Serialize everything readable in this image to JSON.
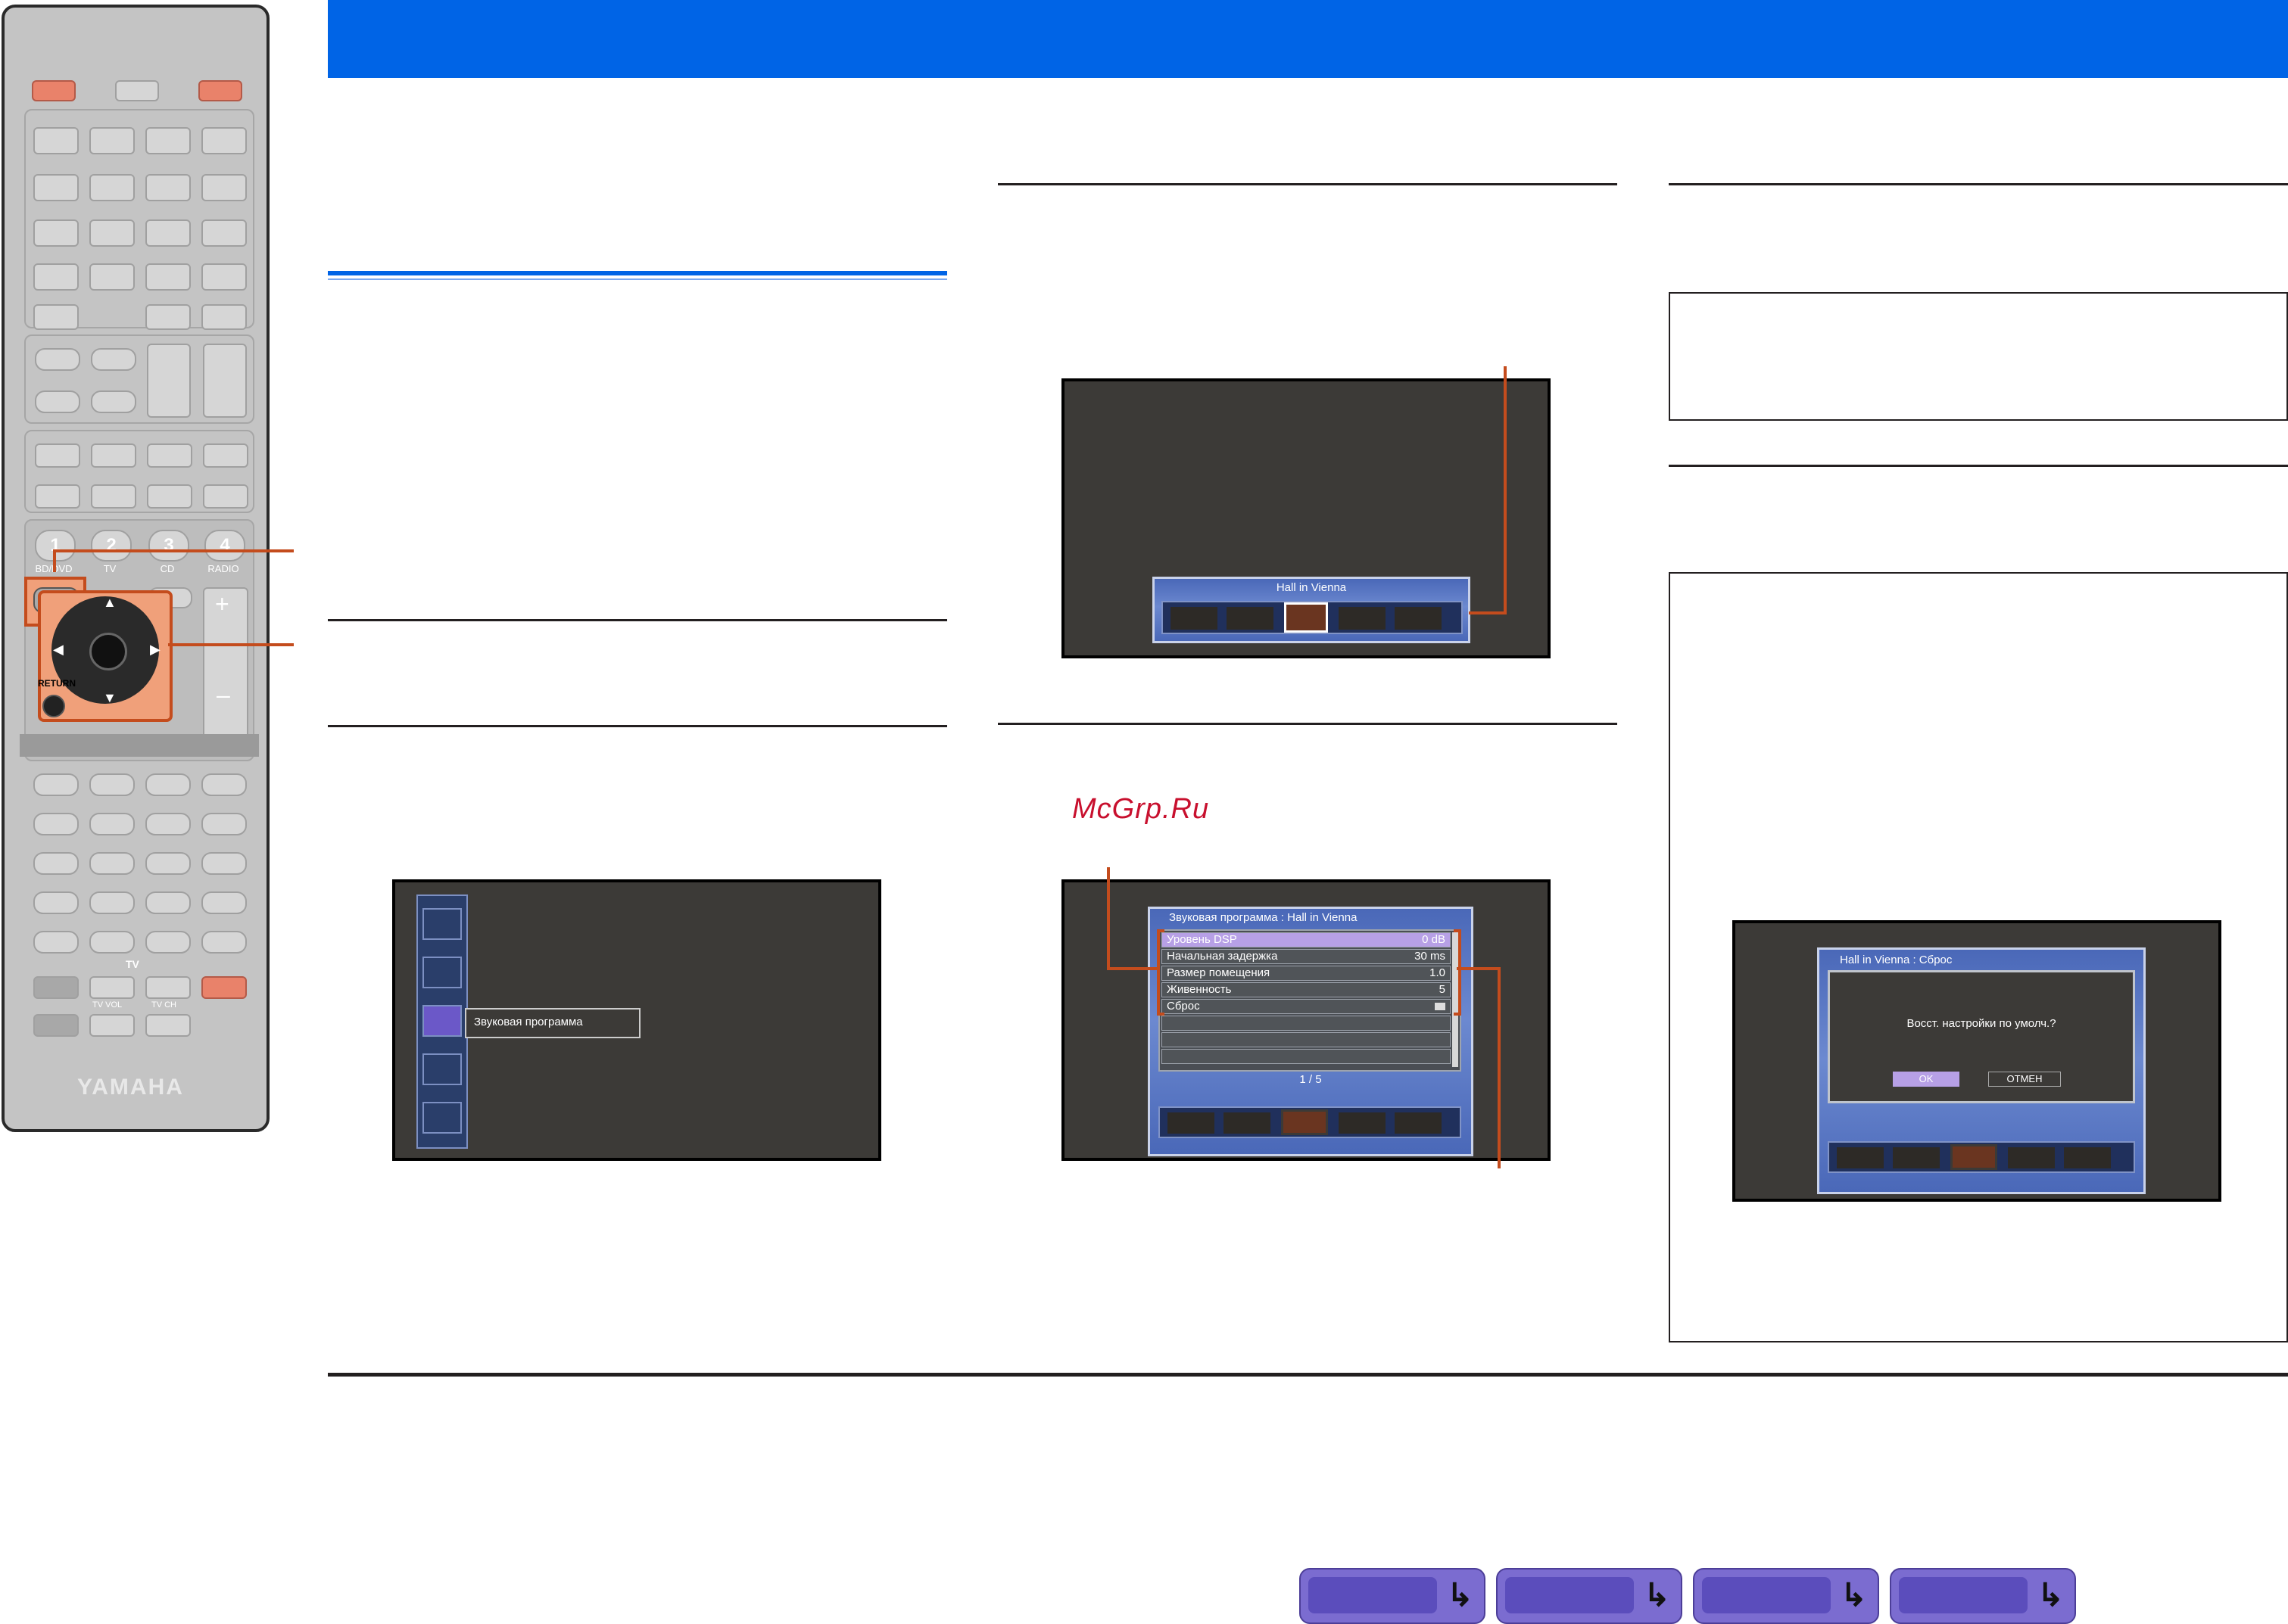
{
  "watermark": "McGrp.Ru",
  "remote": {
    "brand": "YAMAHA",
    "scene_buttons": [
      "1",
      "2",
      "3",
      "4"
    ],
    "scene_labels": [
      "BD/DVD",
      "TV",
      "CD",
      "RADIO"
    ],
    "return_label": "RETURN",
    "tv_label": "TV",
    "tv_vol_label": "TV VOL",
    "tv_ch_label": "TV CH"
  },
  "screen1": {
    "menu_item_label": "Звуковая программа"
  },
  "screen2": {
    "banner_title": "Hall in Vienna"
  },
  "screen3": {
    "header": "Звуковая программа : Hall in Vienna",
    "rows": [
      {
        "label": "Уровень DSP",
        "value": "0 dB"
      },
      {
        "label": "Начальная задержка",
        "value": "30 ms"
      },
      {
        "label": "Размер помещения",
        "value": "1.0"
      },
      {
        "label": "Живенность",
        "value": "5"
      },
      {
        "label": "Сброс",
        "value": ""
      }
    ],
    "page": "1 / 5"
  },
  "screen4": {
    "header": "Hall in Vienna : Сброс",
    "question": "Восст. настройки по умолч.?",
    "ok_label": "OK",
    "cancel_label": "ОТМЕН"
  }
}
